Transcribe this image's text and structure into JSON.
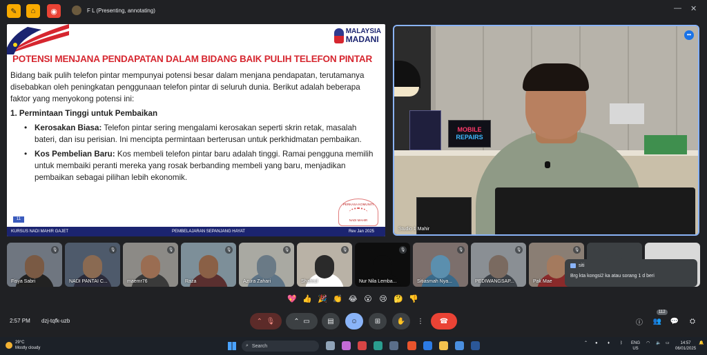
{
  "topbar": {
    "presenter_name": "F L (Presenting, annotating)"
  },
  "slide": {
    "title": "POTENSI MENJANA PENDAPATAN DALAM BIDANG BAIK PULIH TELEFON PINTAR",
    "logo_line1": "MALAYSIA",
    "logo_line2": "MADANI",
    "intro": "Bidang baik pulih telefon pintar mempunyai potensi besar dalam menjana pendapatan, terutamanya disebabkan oleh peningkatan penggunaan telefon pintar di seluruh dunia. Berikut adalah beberapa faktor yang menyokong potensi ini:",
    "heading": "1. Permintaan Tinggi untuk Pembaikan",
    "bullets": [
      {
        "term": "Kerosakan Biasa:",
        "text": " Telefon pintar sering mengalami kerosakan seperti skrin retak, masalah bateri, dan isu perisian. Ini mencipta permintaan berterusan untuk perkhidmatan pembaikan."
      },
      {
        "term": "Kos Pembelian Baru:",
        "text": " Kos membeli telefon pintar baru adalah tinggi. Ramai pengguna memilih untuk membaiki peranti mereka yang rosak berbanding membeli yang baru, menjadikan pembaikan sebagai pilihan lebih ekonomik."
      }
    ],
    "page_number": "11",
    "seal_top": "PERKASA KOMUNITI",
    "seal_bottom": "NADI MAHIR",
    "footer_left": "KURSUS NADI MAHIR  GAJET",
    "footer_center": "PEMBELAJARAN SEPANJANG HAYAT",
    "footer_right": "Rev Jan 2025"
  },
  "presenter_video": {
    "sign_line1": "MOBILE",
    "sign_line2": "REPAIRS",
    "name": "Studio 1 Mahir"
  },
  "participants": [
    {
      "name": "Fisya Sabri",
      "bg": "#6f7680",
      "face": "#7a5a44",
      "torso": "#222"
    },
    {
      "name": "NADI PANTAI C...",
      "bg": "#4e5a6b",
      "face": "#8a6a52",
      "torso": "#2b2b3a"
    },
    {
      "name": "maemr76",
      "bg": "#8c8a86",
      "face": "#9a6d52",
      "torso": "#3a3a3a"
    },
    {
      "name": "Raza",
      "bg": "#7d8f99",
      "face": "#8a6046",
      "torso": "#5a2f2f"
    },
    {
      "name": "Azura Zahari",
      "bg": "#a9a9a2",
      "face": "#6a7a86",
      "torso": "#5e7486"
    },
    {
      "name": "Shahrul",
      "bg": "#b9b2a6",
      "face": "#2a2a2a",
      "torso": "#ffffff"
    },
    {
      "name": "Nur Nila Lemba...",
      "bg": "#0d0d0d",
      "face": "#0d0d0d",
      "torso": "#0d0d0d"
    },
    {
      "name": "Sitiasmah Nya...",
      "bg": "#7c6f6c",
      "face": "#5b8fae",
      "torso": "#3a6a8a"
    },
    {
      "name": "PEDIWANGSAP...",
      "bg": "#8a8f94",
      "face": "#7a6a60",
      "torso": "#3d4248"
    },
    {
      "name": "Pak Mae",
      "bg": "#8a7e74",
      "face": "#a47a5e",
      "torso": "#8a2a2a"
    },
    {
      "name": "",
      "bg": "#3c4043",
      "face": "#3c4043",
      "torso": "#3c4043"
    },
    {
      "name": "",
      "bg": "#d9d9d9",
      "face": "#d9d9d9",
      "torso": "#d9d9d9"
    }
  ],
  "chat_popup": {
    "sender": "siti",
    "message": "Brg kta kongsi2 ka atau sorang 1 d beri"
  },
  "reactions": [
    "💖",
    "👍",
    "🎉",
    "👏",
    "😂",
    "😮",
    "😢",
    "🤔",
    "👎"
  ],
  "controls": {
    "time": "2:57 PM",
    "meeting_code": "dzj-tqfk-uzb",
    "people_count": "112"
  },
  "taskbar": {
    "weather_temp": "29°C",
    "weather_desc": "Mostly cloudy",
    "search_placeholder": "Search",
    "lang_top": "ENG",
    "lang_bottom": "US",
    "clock_time": "14:57",
    "clock_date": "06/01/2025",
    "notif_badge": "1"
  },
  "colors": {
    "accent": "#8ab4f8",
    "slide_title": "#d6262f",
    "slide_footer": "#1b2470",
    "end_call": "#ea4335"
  }
}
